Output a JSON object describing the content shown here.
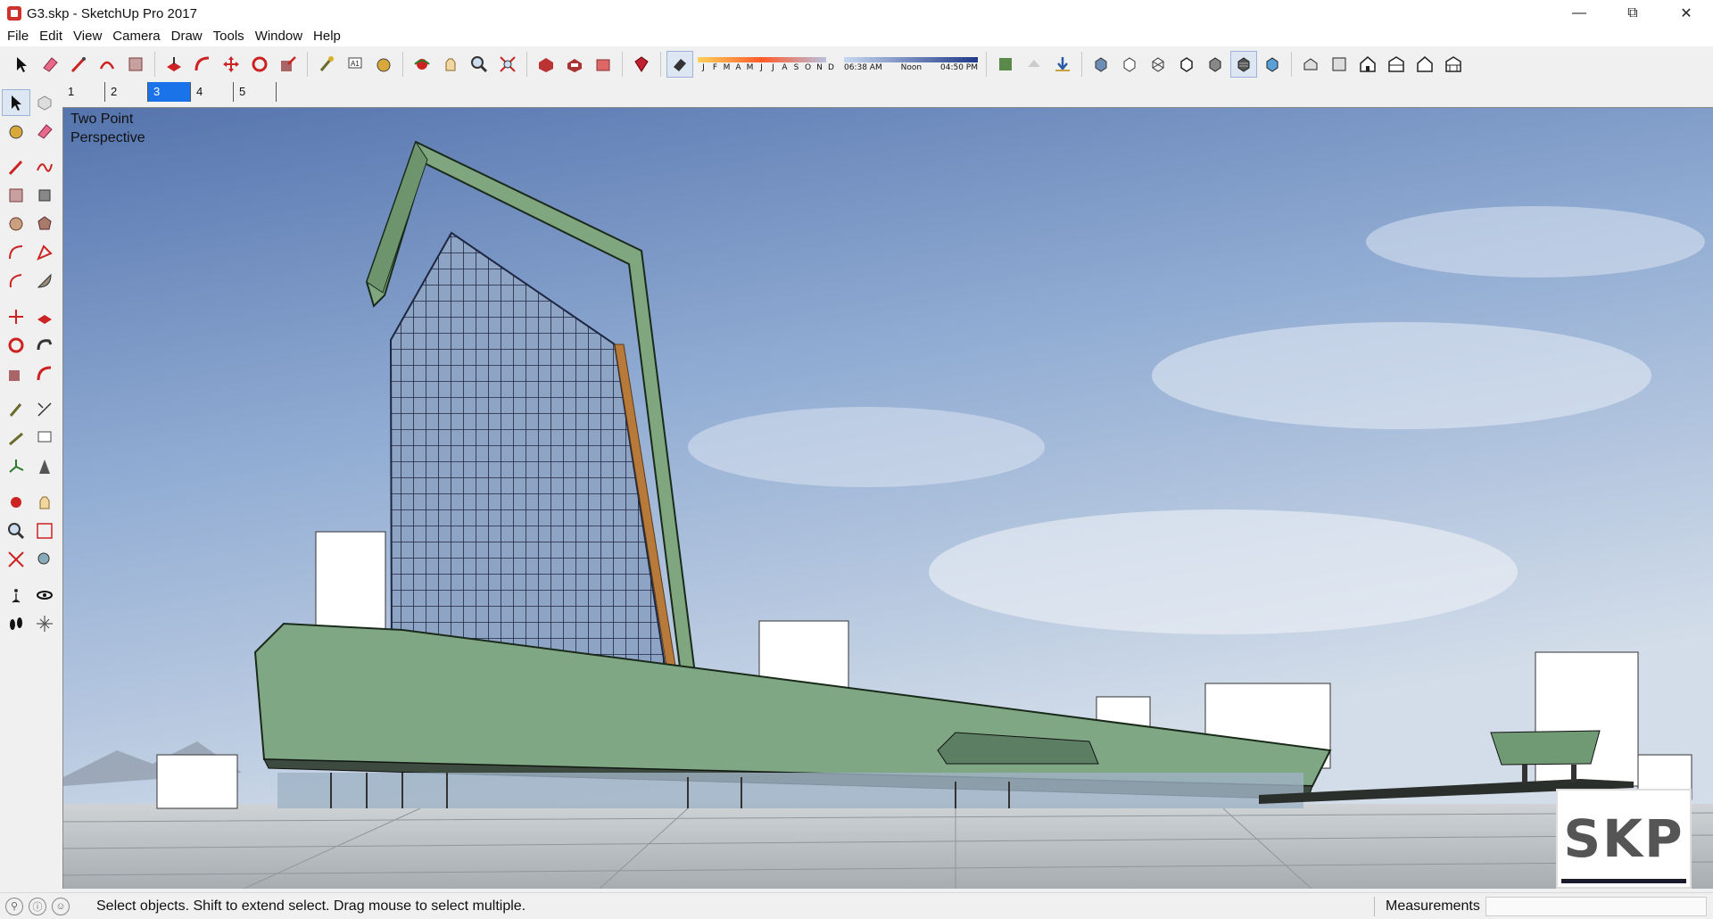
{
  "window": {
    "title": "G3.skp - SketchUp Pro 2017",
    "controls": [
      "minimize-icon",
      "restore-icon",
      "close-icon"
    ]
  },
  "menu": {
    "items": [
      "File",
      "Edit",
      "View",
      "Camera",
      "Draw",
      "Tools",
      "Window",
      "Help"
    ]
  },
  "shadows": {
    "months": [
      "J",
      "F",
      "M",
      "A",
      "M",
      "J",
      "J",
      "A",
      "S",
      "O",
      "N",
      "D"
    ],
    "time_start": "06:38 AM",
    "time_mid": "Noon",
    "time_end": "04:50 PM"
  },
  "scenes": {
    "tabs": [
      "1",
      "2",
      "3",
      "4",
      "5"
    ],
    "active_index": 2
  },
  "viewport": {
    "camera_line1": "Two Point",
    "camera_line2": "Perspective",
    "watermark": "SKP",
    "colors": {
      "building_green": "#7fa67f",
      "sky_top": "#5d7fb8",
      "glass": "#3b4767",
      "wood_accent": "#b87a3a"
    }
  },
  "status": {
    "hint": "Select objects. Shift to extend select. Drag mouse to select multiple.",
    "measurements_label": "Measurements",
    "measurements_value": ""
  }
}
